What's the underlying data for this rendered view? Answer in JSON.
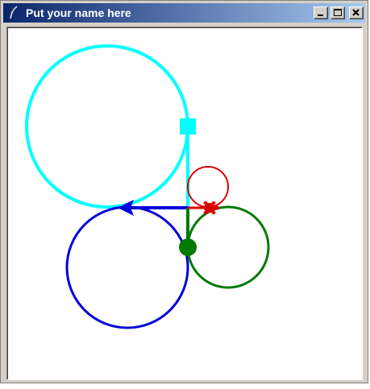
{
  "window": {
    "title": "Put your name here",
    "buttons": {
      "minimize": "minimize",
      "maximize": "maximize",
      "close": "close"
    }
  },
  "colors": {
    "titlebar_start": "#0a246a",
    "titlebar_end": "#a6caf0",
    "canvas_background": "#ffffff",
    "cyan": "#00ffff",
    "blue": "#0000dd",
    "green": "#007a00",
    "red": "#dd0000"
  }
}
